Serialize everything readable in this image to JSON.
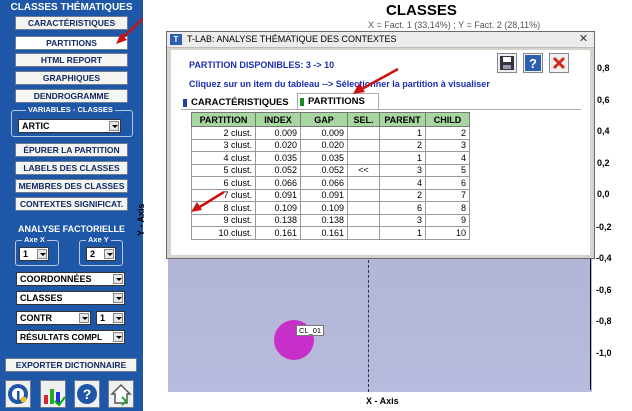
{
  "left_panel": {
    "title": "CLASSES THÉMATIQUES",
    "buttons": [
      "CARACTÉRISTIQUES",
      "PARTITIONS",
      "HTML REPORT",
      "GRAPHIQUES",
      "DENDROGRAMME"
    ],
    "variables_label": "VARIABLES - CLASSES",
    "variable_value": "ARTIC",
    "buttons2": [
      "ÉPURER LA PARTITION",
      "LABELS DES CLASSES",
      "MEMBRES DES CLASSES",
      "CONTEXTES SIGNIFICAT."
    ],
    "analyse_title": "ANALYSE FACTORIELLE",
    "axe_x_label": "Axe X",
    "axe_y_label": "Axe Y",
    "axe_x_value": "1",
    "axe_y_value": "2",
    "coord": "COORDONNÉES",
    "classes": "CLASSES",
    "contr": "CONTR",
    "contr_num": "1",
    "resultats": "RÉSULTATS COMPL",
    "export": "EXPORTER DICTIONNAIRE",
    "icons": [
      "info-icon",
      "chart-icon",
      "help-icon",
      "home-icon"
    ]
  },
  "chart": {
    "title": "CLASSES",
    "subtitle": "X = Fact. 1 (33,14%) ; Y = Fact. 2 (28,11%)",
    "y_axis_label": "Y - Axis",
    "x_axis_label": "X - Axis",
    "y_ticks": [
      "0,8",
      "0,6",
      "0,4",
      "0,2",
      "0,0",
      "-0,2",
      "-0,4",
      "-0,6",
      "-0,8",
      "-1,0"
    ],
    "point_label": "CL_01",
    "point_color": "#c62fc8"
  },
  "dialog": {
    "title": "T-LAB: ANALYSE THÉMATIQUE DES CONTEXTES",
    "info1": "PARTITION  DISPONIBLES: 3 -> 10",
    "info2": "Cliquez sur un item du tableau --> Sélectionner la partition à visualiser",
    "tab1": "CARACTÉRISTIQUES",
    "tab2": "PARTITIONS",
    "columns": [
      "PARTITION",
      "INDEX",
      "GAP",
      "SEL.",
      "PARENT",
      "CHILD"
    ],
    "rows": [
      [
        "2 clust.",
        "0.009",
        "0.009",
        "",
        "1",
        "2"
      ],
      [
        "3 clust.",
        "0.020",
        "0.020",
        "",
        "2",
        "3"
      ],
      [
        "4 clust.",
        "0.035",
        "0.035",
        "",
        "1",
        "4"
      ],
      [
        "5 clust.",
        "0.052",
        "0.052",
        "<<",
        "3",
        "5"
      ],
      [
        "6 clust.",
        "0.066",
        "0.066",
        "",
        "4",
        "6"
      ],
      [
        "7 clust.",
        "0.091",
        "0.091",
        "",
        "2",
        "7"
      ],
      [
        "8 clust.",
        "0.109",
        "0.109",
        "",
        "6",
        "8"
      ],
      [
        "9 clust.",
        "0.138",
        "0.138",
        "",
        "3",
        "9"
      ],
      [
        "10 clust.",
        "0.161",
        "0.161",
        "",
        "1",
        "10"
      ]
    ]
  },
  "colors": {
    "panel_blue": "#1e56a8",
    "header_green": "#a8d6a0",
    "info_blue": "#1b2fb0",
    "arrow_red": "#cc1111"
  }
}
